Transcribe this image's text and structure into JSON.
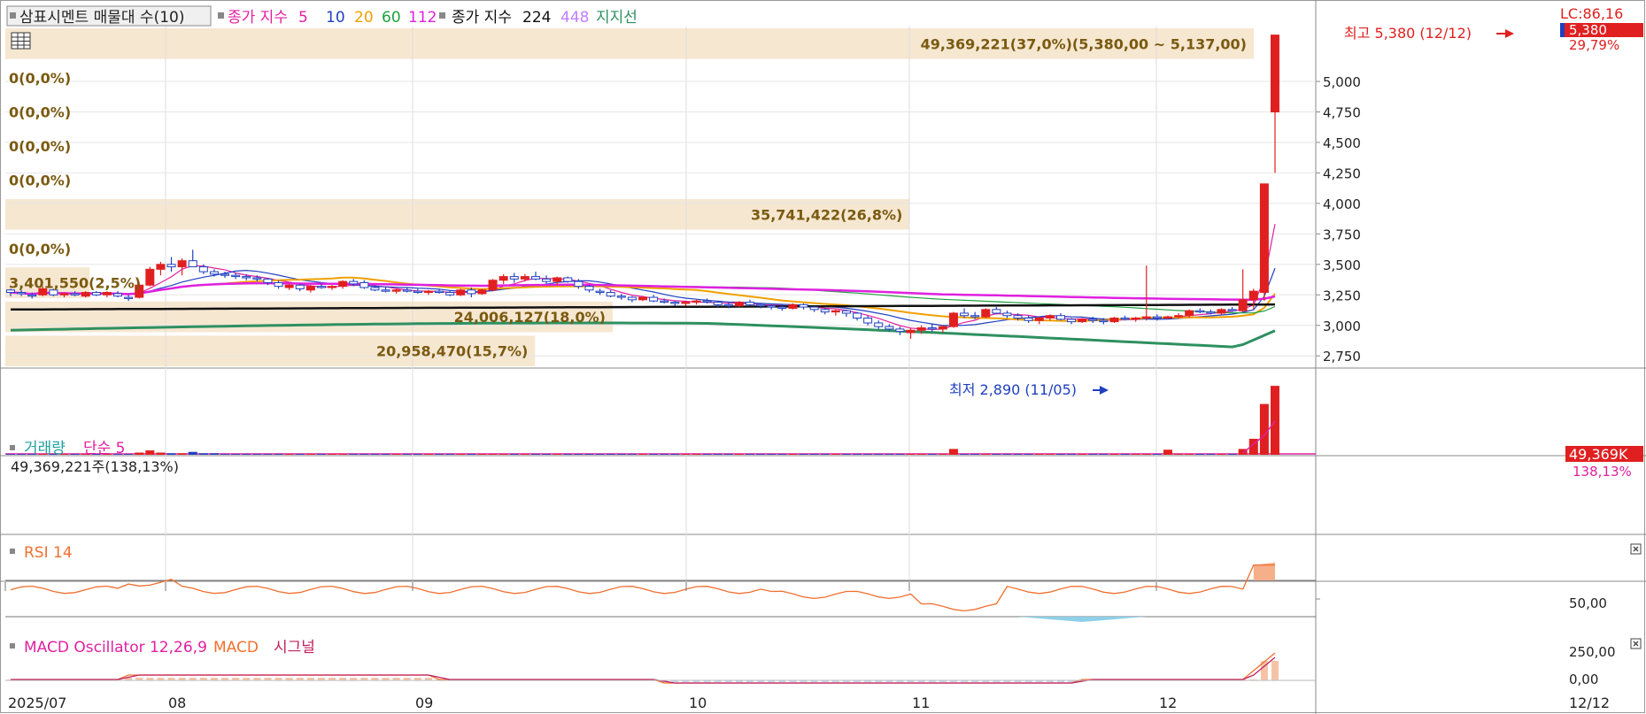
{
  "title": "삼표시멘트 매물대 수(10)",
  "legend": {
    "label": "종가 지수",
    "ma": [
      "5",
      "10",
      "20",
      "60",
      "112"
    ],
    "label2": "종가 지수",
    "ma2": [
      "224",
      "448"
    ],
    "support": "지지선"
  },
  "colors": {
    "up": "#e02020",
    "down": "#2040c0",
    "ma5": "#e020a0",
    "ma10": "#2040c0",
    "ma20": "#f0a000",
    "ma60": "#20a040",
    "ma112": "#e020e0",
    "ma224": "#111111",
    "ma448": "#c080ff",
    "support": "#2e9060",
    "band": "#f5e4cc",
    "bandText": "#7a5a10",
    "volLabel": "#20a0a0"
  },
  "price_axis": [
    "5,000",
    "4,750",
    "4,500",
    "4,250",
    "4,000",
    "3,750",
    "3,500",
    "3,250",
    "3,000",
    "2,750"
  ],
  "price_box": {
    "lc": "LC:86,16",
    "current": "5,380",
    "change": "29,79%"
  },
  "volume_profile": [
    {
      "label": "49,369,221(37,0%)(5,380,00 ~ 5,137,00)"
    },
    {
      "label": "0(0,0%)"
    },
    {
      "label": "0(0,0%)"
    },
    {
      "label": "0(0,0%)"
    },
    {
      "label": "0(0,0%)"
    },
    {
      "label": "35,741,422(26,8%)"
    },
    {
      "label": "0(0,0%)"
    },
    {
      "label": "3,401,550(2,5%)"
    },
    {
      "label": "24,006,127(18,0%)"
    },
    {
      "label": "20,958,470(15,7%)"
    }
  ],
  "annotations": {
    "high": "최고 5,380 (12/12)",
    "low": "최저 2,890 (11/05)"
  },
  "volume_panel": {
    "title": "거래량",
    "ma": "단순 5",
    "info": "49,369,221주(138,13%)",
    "box_value": "49,369K",
    "box_pct": "138,13%"
  },
  "rsi_panel": {
    "title": "RSI 14",
    "axis": "50,00"
  },
  "macd_panel": {
    "title": "MACD Oscillator 12,26,9",
    "macd": "MACD",
    "signal": "시그널",
    "axis": [
      "250,00",
      "0,00"
    ]
  },
  "x_axis": {
    "labels": [
      "2025/07",
      "08",
      "09",
      "10",
      "11",
      "12"
    ],
    "last": "12/12"
  },
  "chart_data": {
    "type": "candlestick",
    "title": "삼표시멘트 매물대 수(10)",
    "x_ticks": [
      "2025/07",
      "08",
      "09",
      "10",
      "11",
      "12"
    ],
    "y_range": [
      2650,
      5450
    ],
    "high": {
      "value": 5380,
      "date": "12/12"
    },
    "low": {
      "value": 2890,
      "date": "11/05"
    },
    "ohlc": [
      [
        3290,
        3300,
        3240,
        3270
      ],
      [
        3270,
        3290,
        3240,
        3260
      ],
      [
        3250,
        3270,
        3220,
        3240
      ],
      [
        3250,
        3320,
        3240,
        3300
      ],
      [
        3290,
        3300,
        3240,
        3250
      ],
      [
        3250,
        3270,
        3230,
        3260
      ],
      [
        3260,
        3280,
        3240,
        3250
      ],
      [
        3240,
        3280,
        3230,
        3270
      ],
      [
        3270,
        3280,
        3240,
        3250
      ],
      [
        3250,
        3280,
        3230,
        3270
      ],
      [
        3260,
        3280,
        3230,
        3240
      ],
      [
        3230,
        3250,
        3200,
        3220
      ],
      [
        3230,
        3350,
        3220,
        3330
      ],
      [
        3330,
        3480,
        3320,
        3460
      ],
      [
        3460,
        3520,
        3410,
        3500
      ],
      [
        3500,
        3560,
        3440,
        3480
      ],
      [
        3480,
        3550,
        3410,
        3530
      ],
      [
        3530,
        3620,
        3480,
        3480
      ],
      [
        3480,
        3500,
        3420,
        3440
      ],
      [
        3440,
        3460,
        3400,
        3420
      ],
      [
        3420,
        3440,
        3390,
        3410
      ],
      [
        3410,
        3430,
        3380,
        3400
      ],
      [
        3400,
        3420,
        3370,
        3390
      ],
      [
        3390,
        3410,
        3360,
        3380
      ],
      [
        3380,
        3390,
        3330,
        3350
      ],
      [
        3350,
        3370,
        3300,
        3320
      ],
      [
        3310,
        3340,
        3290,
        3330
      ],
      [
        3330,
        3340,
        3280,
        3300
      ],
      [
        3290,
        3330,
        3270,
        3320
      ],
      [
        3320,
        3340,
        3300,
        3310
      ],
      [
        3310,
        3330,
        3290,
        3320
      ],
      [
        3320,
        3370,
        3300,
        3360
      ],
      [
        3360,
        3380,
        3320,
        3340
      ],
      [
        3350,
        3370,
        3300,
        3310
      ],
      [
        3310,
        3330,
        3280,
        3290
      ],
      [
        3290,
        3310,
        3270,
        3280
      ],
      [
        3280,
        3300,
        3260,
        3290
      ],
      [
        3290,
        3310,
        3270,
        3280
      ],
      [
        3280,
        3300,
        3260,
        3270
      ],
      [
        3270,
        3290,
        3250,
        3280
      ],
      [
        3280,
        3300,
        3260,
        3270
      ],
      [
        3270,
        3290,
        3240,
        3250
      ],
      [
        3250,
        3300,
        3240,
        3290
      ],
      [
        3290,
        3310,
        3230,
        3260
      ],
      [
        3260,
        3300,
        3250,
        3290
      ],
      [
        3290,
        3380,
        3280,
        3370
      ],
      [
        3370,
        3420,
        3340,
        3400
      ],
      [
        3400,
        3430,
        3350,
        3380
      ],
      [
        3380,
        3420,
        3360,
        3400
      ],
      [
        3400,
        3440,
        3370,
        3380
      ],
      [
        3380,
        3410,
        3340,
        3360
      ],
      [
        3360,
        3400,
        3330,
        3390
      ],
      [
        3390,
        3400,
        3350,
        3360
      ],
      [
        3360,
        3380,
        3300,
        3320
      ],
      [
        3320,
        3330,
        3270,
        3290
      ],
      [
        3280,
        3300,
        3250,
        3270
      ],
      [
        3270,
        3290,
        3230,
        3240
      ],
      [
        3240,
        3260,
        3210,
        3230
      ],
      [
        3230,
        3240,
        3190,
        3210
      ],
      [
        3210,
        3240,
        3200,
        3230
      ],
      [
        3230,
        3250,
        3190,
        3200
      ],
      [
        3200,
        3220,
        3180,
        3190
      ],
      [
        3190,
        3200,
        3160,
        3180
      ],
      [
        3180,
        3200,
        3160,
        3190
      ],
      [
        3190,
        3210,
        3170,
        3200
      ],
      [
        3200,
        3220,
        3180,
        3190
      ],
      [
        3190,
        3200,
        3150,
        3170
      ],
      [
        3170,
        3190,
        3140,
        3160
      ],
      [
        3160,
        3200,
        3150,
        3190
      ],
      [
        3190,
        3210,
        3160,
        3170
      ],
      [
        3170,
        3180,
        3140,
        3160
      ],
      [
        3160,
        3170,
        3130,
        3150
      ],
      [
        3150,
        3170,
        3120,
        3140
      ],
      [
        3140,
        3180,
        3130,
        3170
      ],
      [
        3170,
        3180,
        3130,
        3150
      ],
      [
        3150,
        3160,
        3110,
        3130
      ],
      [
        3130,
        3140,
        3090,
        3110
      ],
      [
        3110,
        3130,
        3080,
        3120
      ],
      [
        3120,
        3130,
        3070,
        3100
      ],
      [
        3100,
        3110,
        3040,
        3060
      ],
      [
        3060,
        3080,
        3000,
        3020
      ],
      [
        3020,
        3040,
        2970,
        2990
      ],
      [
        2990,
        3010,
        2950,
        2970
      ],
      [
        2970,
        2990,
        2920,
        2950
      ],
      [
        2940,
        2980,
        2890,
        2960
      ],
      [
        2960,
        3000,
        2930,
        2980
      ],
      [
        2980,
        3010,
        2950,
        2970
      ],
      [
        2970,
        3000,
        2940,
        2990
      ],
      [
        2990,
        3110,
        2980,
        3100
      ],
      [
        3100,
        3140,
        3060,
        3080
      ],
      [
        3080,
        3110,
        3050,
        3070
      ],
      [
        3070,
        3140,
        3060,
        3130
      ],
      [
        3130,
        3150,
        3090,
        3100
      ],
      [
        3100,
        3120,
        3060,
        3080
      ],
      [
        3080,
        3100,
        3040,
        3060
      ],
      [
        3060,
        3080,
        3020,
        3040
      ],
      [
        3040,
        3070,
        3010,
        3060
      ],
      [
        3060,
        3090,
        3040,
        3080
      ],
      [
        3080,
        3100,
        3040,
        3050
      ],
      [
        3050,
        3060,
        3010,
        3030
      ],
      [
        3030,
        3060,
        3020,
        3050
      ],
      [
        3050,
        3070,
        3020,
        3040
      ],
      [
        3040,
        3060,
        3010,
        3030
      ],
      [
        3030,
        3070,
        3020,
        3060
      ],
      [
        3060,
        3080,
        3040,
        3050
      ],
      [
        3050,
        3070,
        3030,
        3060
      ],
      [
        3060,
        3490,
        3040,
        3070
      ],
      [
        3070,
        3090,
        3040,
        3060
      ],
      [
        3060,
        3080,
        3050,
        3070
      ],
      [
        3070,
        3100,
        3060,
        3080
      ],
      [
        3080,
        3130,
        3060,
        3120
      ],
      [
        3120,
        3140,
        3100,
        3110
      ],
      [
        3110,
        3130,
        3090,
        3100
      ],
      [
        3100,
        3140,
        3090,
        3130
      ],
      [
        3130,
        3150,
        3110,
        3120
      ],
      [
        3120,
        3460,
        3110,
        3210
      ],
      [
        3210,
        3300,
        3130,
        3280
      ],
      [
        3270,
        4160,
        3200,
        4160
      ],
      [
        4750,
        5380,
        4250,
        5380
      ]
    ]
  }
}
